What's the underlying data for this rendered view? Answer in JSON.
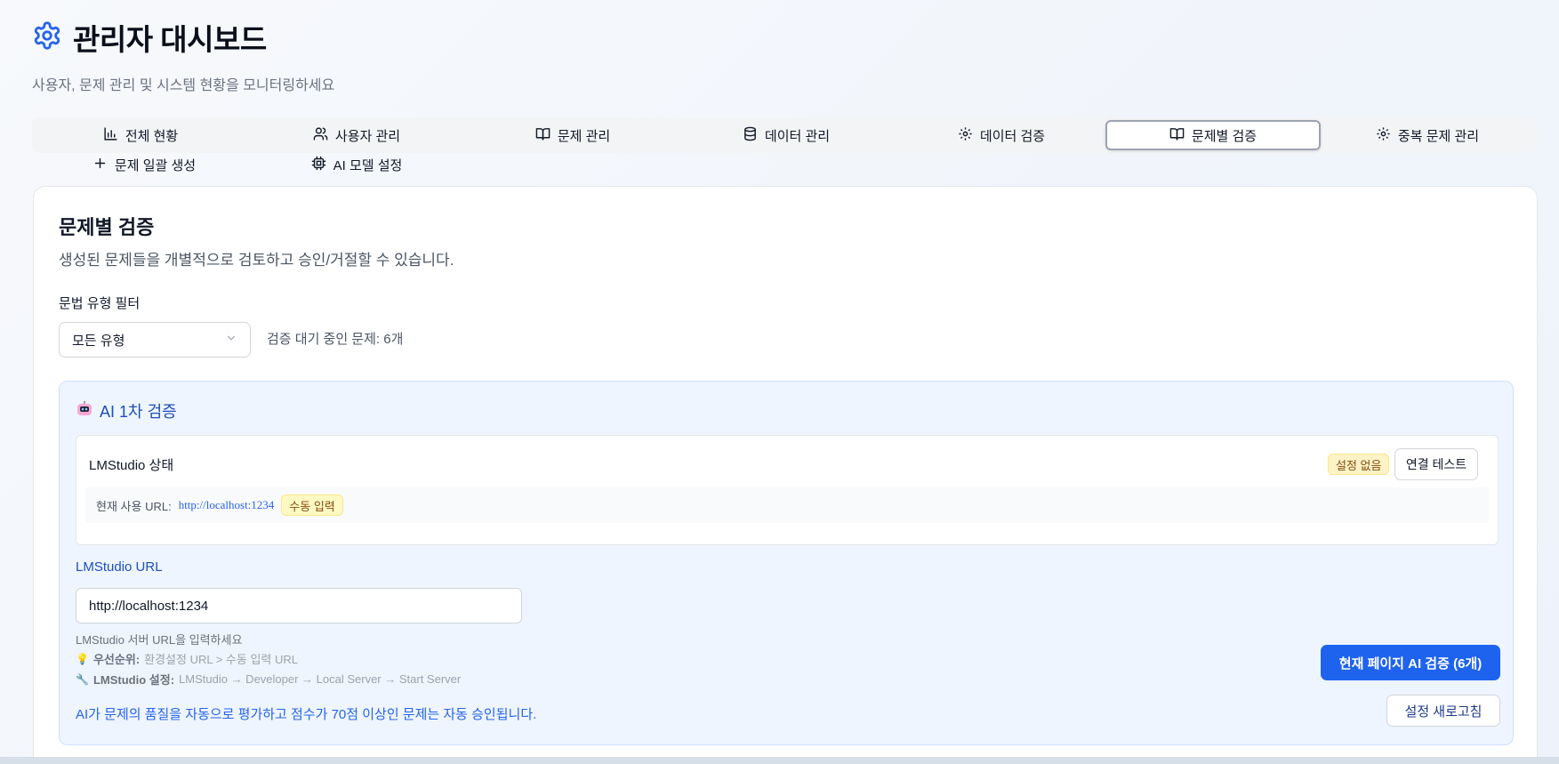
{
  "header": {
    "title": "관리자 대시보드",
    "subtitle": "사용자, 문제 관리 및 시스템 현황을 모니터링하세요",
    "icon": "gear-icon",
    "accent_color": "#2563eb"
  },
  "tabs": [
    {
      "label": "전체 현황",
      "icon": "bar-chart-icon"
    },
    {
      "label": "사용자 관리",
      "icon": "users-icon"
    },
    {
      "label": "문제 관리",
      "icon": "book-open-icon"
    },
    {
      "label": "데이터 관리",
      "icon": "database-icon"
    },
    {
      "label": "데이터 검증",
      "icon": "gear-icon"
    },
    {
      "label": "문제별 검증",
      "icon": "book-open-icon",
      "active": true
    },
    {
      "label": "중복 문제 관리",
      "icon": "gear-icon"
    },
    {
      "label": "문제 일괄 생성",
      "icon": "plus-icon"
    },
    {
      "label": "AI 모델 설정",
      "icon": "cpu-icon"
    }
  ],
  "main": {
    "title": "문제별 검증",
    "description": "생성된 문제들을 개별적으로 검토하고 승인/거절할 수 있습니다.",
    "filter_label": "문법 유형 필터",
    "filter_value": "모든 유형",
    "pending_text": "검증 대기 중인 문제: 6개"
  },
  "ai": {
    "title": "AI 1차 검증",
    "status_label": "LMStudio 상태",
    "status_badge": "설정 없음",
    "test_button": "연결 테스트",
    "current_url_label": "현재 사용 URL:",
    "current_url": "http://localhost:1234",
    "url_mode_badge": "수동 입력",
    "url_field_label": "LMStudio URL",
    "url_field_value": "http://localhost:1234",
    "hint_enter": "LMStudio 서버 URL을 입력하세요",
    "priority_label": "우선순위:",
    "priority_text": "환경설정 URL > 수동 입력 URL",
    "setup_label": "LMStudio 설정:",
    "setup_text": "LMStudio → Developer → Local Server → Start Server",
    "note": "AI가 문제의 품질을 자동으로 평가하고 점수가 70점 이상인 문제는 자동 승인됩니다.",
    "verify_button": "현재 페이지 AI 검증 (6개)",
    "refresh_button": "설정 새로고침"
  }
}
